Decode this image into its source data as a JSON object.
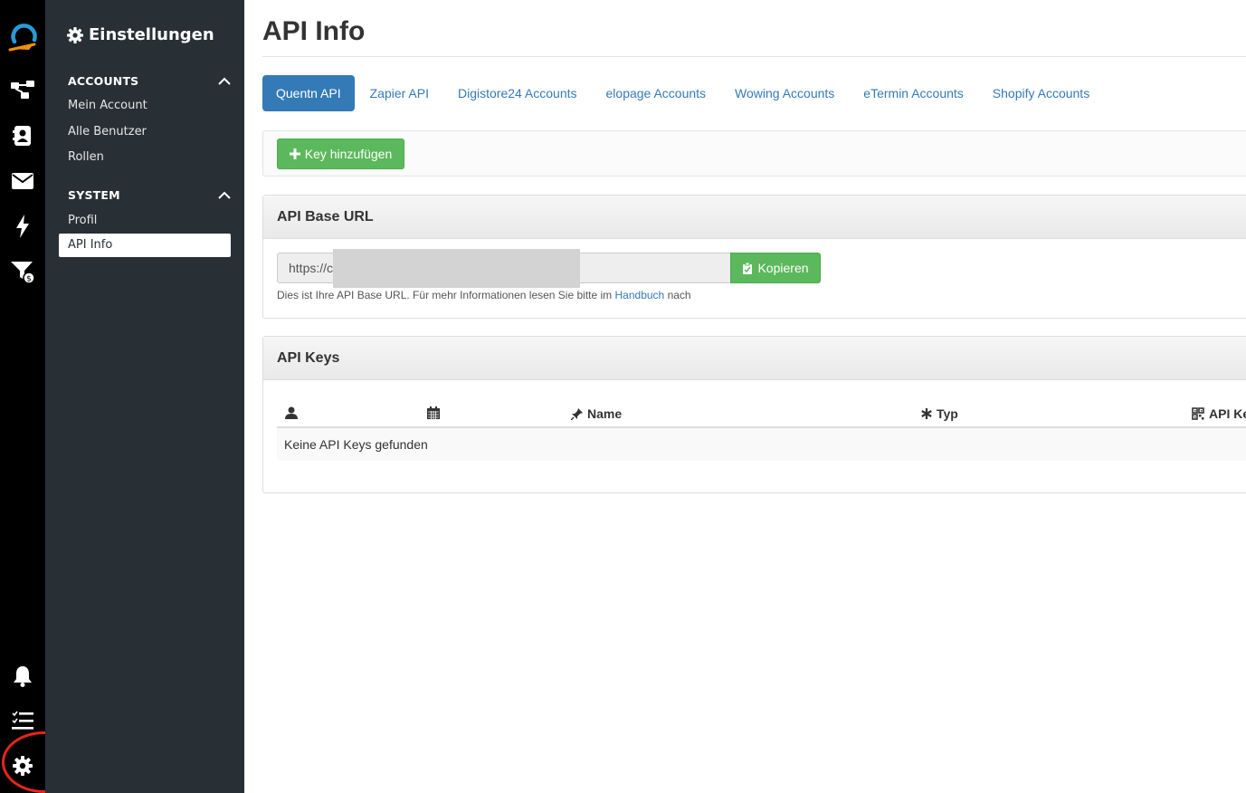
{
  "sidebar": {
    "title": "Einstellungen",
    "sections": [
      {
        "label": "ACCOUNTS",
        "items": [
          "Mein Account",
          "Alle Benutzer",
          "Rollen"
        ]
      },
      {
        "label": "SYSTEM",
        "items": [
          "Profil",
          "API Info"
        ]
      }
    ],
    "active_item": "API Info"
  },
  "rail": {
    "brand_color": "#2a9ad6",
    "accent_color": "#f39200",
    "top_icons": [
      "logo-icon",
      "funnel-flow-icon",
      "contacts-icon",
      "mail-icon",
      "bolt-icon",
      "sales-filter-icon"
    ],
    "bottom_icons": [
      "bell-icon",
      "tasks-icon",
      "gear-icon"
    ],
    "highlight_color": "#e8241c"
  },
  "main": {
    "title": "API Info",
    "tabs": [
      "Quentn API",
      "Zapier API",
      "Digistore24 Accounts",
      "elopage Accounts",
      "Wowing Accounts",
      "eTermin Accounts",
      "Shopify Accounts"
    ],
    "active_tab": "Quentn API",
    "add_key_label": "Key hinzufügen",
    "base_url": {
      "title": "API Base URL",
      "value": "https://c",
      "copy_label": "Kopieren",
      "help_prefix": "Dies ist Ihre API Base URL. Für mehr Informationen lesen Sie bitte im",
      "help_link": "Handbuch",
      "help_suffix": "nach"
    },
    "keys": {
      "title": "API Keys",
      "columns": [
        "",
        "",
        "Name",
        "Typ",
        "API Ke"
      ],
      "column_icons": [
        "user-icon",
        "calendar-icon",
        "pin-icon",
        "asterisk-icon",
        "qrcode-icon"
      ],
      "empty_text": "Keine API Keys gefunden"
    }
  },
  "colors": {
    "primary": "#337ab7",
    "success": "#5cb85c",
    "sidebar_bg": "#283035",
    "rail_bg": "#000000"
  }
}
